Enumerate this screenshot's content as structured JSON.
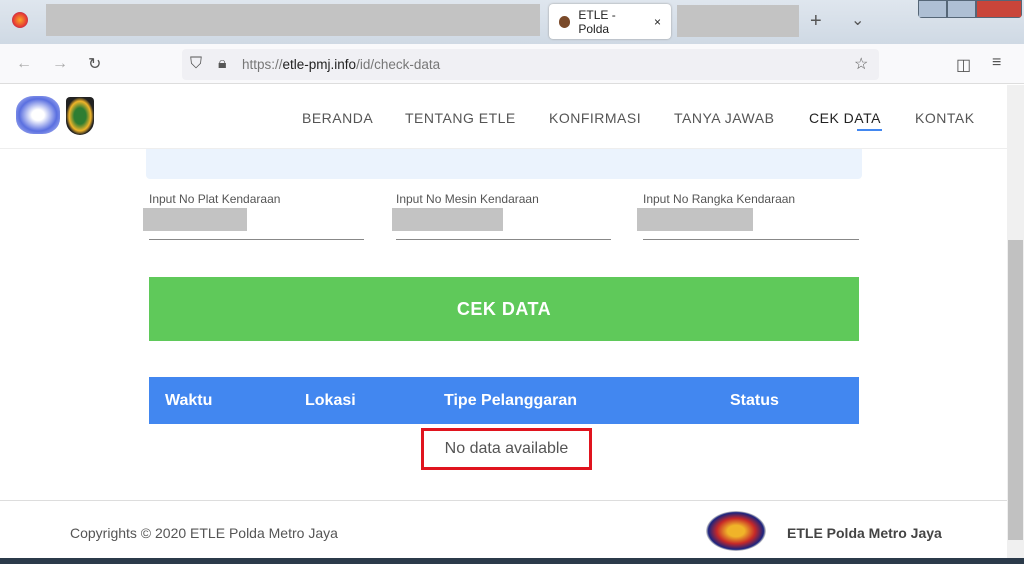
{
  "browser": {
    "tab_title": "ETLE - Polda",
    "url_host": "etle-pmj.info",
    "url_scheme": "https://",
    "url_path": "/id/check-data",
    "close": "×",
    "new_tab": "+",
    "list_tabs": "⌄"
  },
  "nav": {
    "items": [
      "BERANDA",
      "TENTANG ETLE",
      "KONFIRMASI",
      "TANYA JAWAB",
      "CEK DATA",
      "KONTAK"
    ],
    "active": "CEK DATA"
  },
  "form": {
    "plat_label": "Input No Plat Kendaraan",
    "mesin_label": "Input No Mesin Kendaraan",
    "rangka_label": "Input No Rangka Kendaraan",
    "submit": "CEK DATA"
  },
  "table": {
    "headers": [
      "Waktu",
      "Lokasi",
      "Tipe Pelanggaran",
      "Status"
    ],
    "empty": "No data available"
  },
  "footer": {
    "copyright": "Copyrights © 2020 ETLE Polda Metro Jaya",
    "brand": "ETLE Polda Metro Jaya"
  },
  "colors": {
    "accent": "#4287f0",
    "button": "#5fc95a",
    "highlight": "#e0141e"
  }
}
